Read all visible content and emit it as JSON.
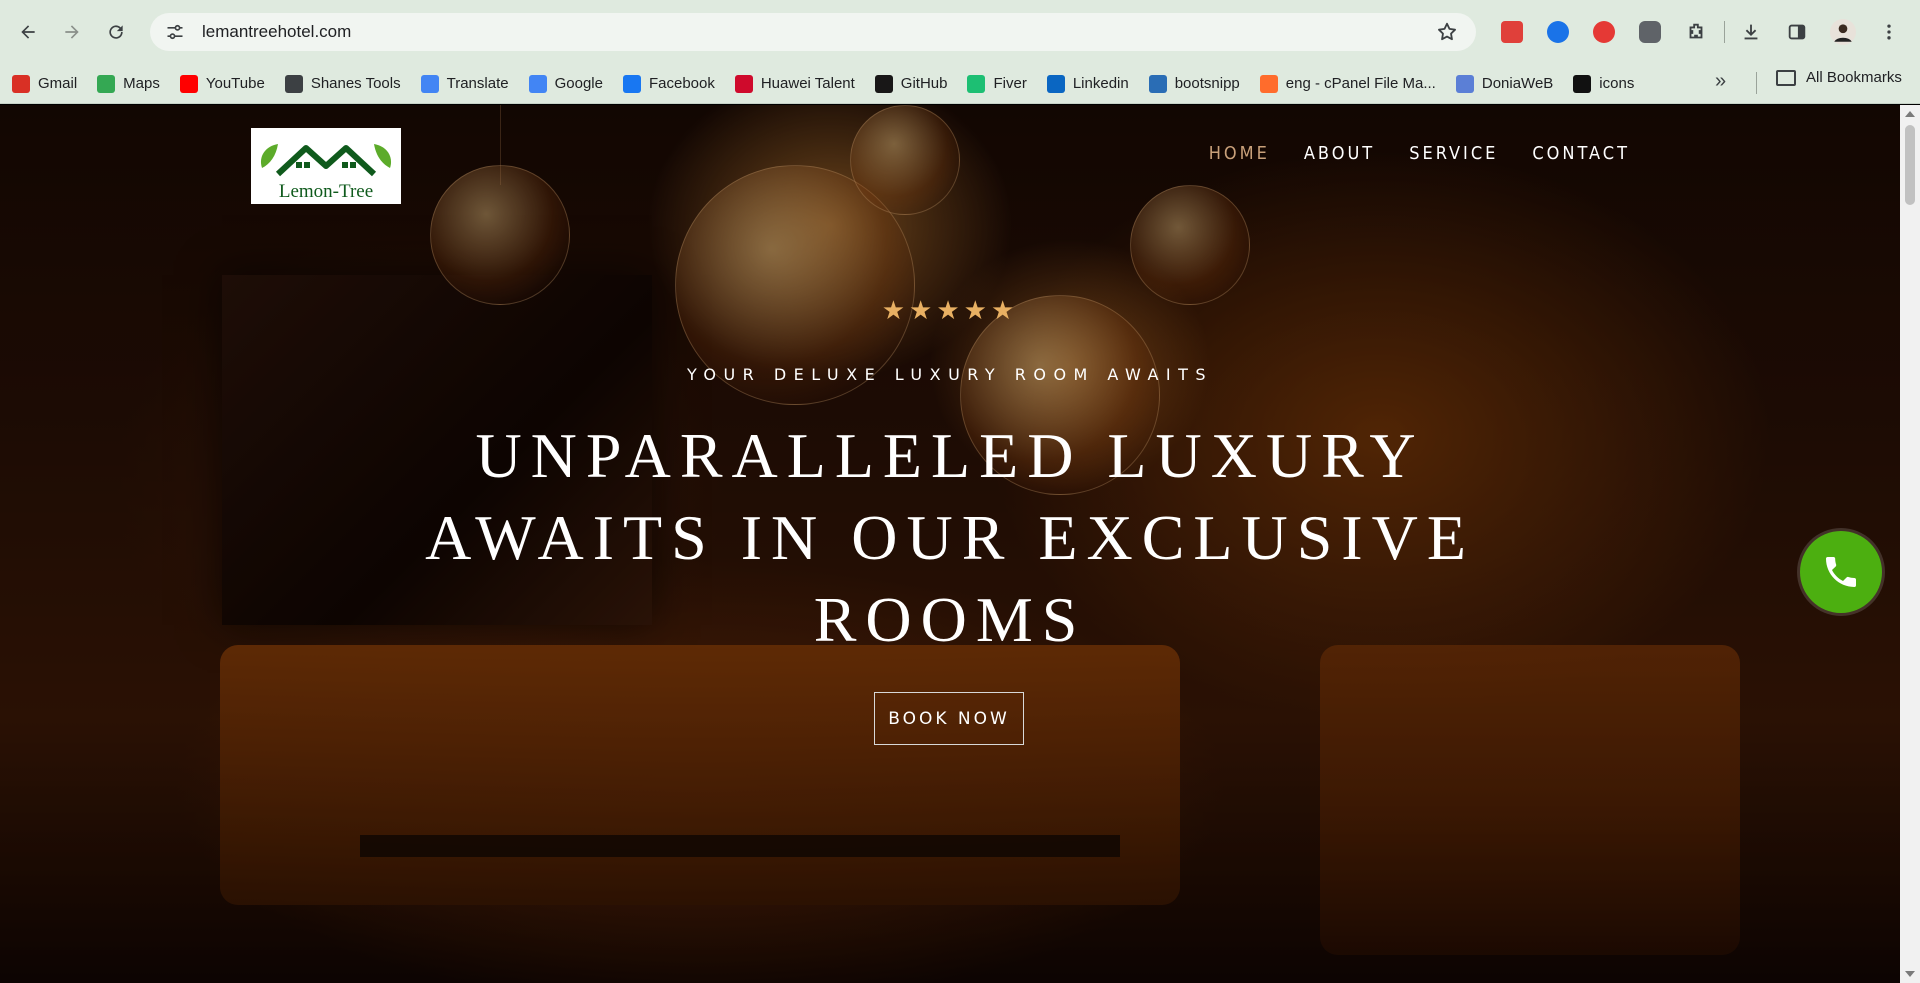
{
  "browser": {
    "url": "lemantreehotel.com",
    "bookmarks": [
      {
        "label": "Gmail",
        "icon": "gmail-icon",
        "color": "#d93025"
      },
      {
        "label": "Maps",
        "icon": "maps-icon",
        "color": "#34a853"
      },
      {
        "label": "YouTube",
        "icon": "youtube-icon",
        "color": "#ff0000"
      },
      {
        "label": "Shanes Tools",
        "icon": "globe-icon",
        "color": "#3c4043"
      },
      {
        "label": "Translate",
        "icon": "translate-icon",
        "color": "#4285f4"
      },
      {
        "label": "Google",
        "icon": "google-icon",
        "color": "#4285f4"
      },
      {
        "label": "Facebook",
        "icon": "facebook-icon",
        "color": "#1877f2"
      },
      {
        "label": "Huawei Talent",
        "icon": "huawei-icon",
        "color": "#cf0a2c"
      },
      {
        "label": "GitHub",
        "icon": "github-icon",
        "color": "#181717"
      },
      {
        "label": "Fiver",
        "icon": "fiverr-icon",
        "color": "#1dbf73"
      },
      {
        "label": "Linkedin",
        "icon": "linkedin-icon",
        "color": "#0a66c2"
      },
      {
        "label": "bootsnipp",
        "icon": "bootsnipp-icon",
        "color": "#2a6db5"
      },
      {
        "label": "eng - cPanel File Ma...",
        "icon": "cpanel-icon",
        "color": "#ff6c2c"
      },
      {
        "label": "DoniaWeB",
        "icon": "doniaweb-icon",
        "color": "#5b7fd6"
      },
      {
        "label": "icons",
        "icon": "icons-icon",
        "color": "#111111"
      }
    ],
    "all_bookmarks": "All Bookmarks"
  },
  "site": {
    "logo_text": "Lemon-Tree",
    "nav": [
      {
        "label": "HOME",
        "active": true
      },
      {
        "label": "ABOUT",
        "active": false
      },
      {
        "label": "SERVICE",
        "active": false
      },
      {
        "label": "CONTACT",
        "active": false
      }
    ],
    "hero": {
      "stars": "★★★★★",
      "rating": 5,
      "subtitle": "YOUR DELUXE LUXURY ROOM AWAITS",
      "headline": "UNPARALLELED LUXURY AWAITS IN OUR EXCLUSIVE ROOMS",
      "cta": "BOOK NOW"
    },
    "colors": {
      "nav_active": "#c9a07a",
      "stars": "#e8b063",
      "call_button": "#4caf10",
      "logo_green": "#0f5a1c"
    }
  }
}
